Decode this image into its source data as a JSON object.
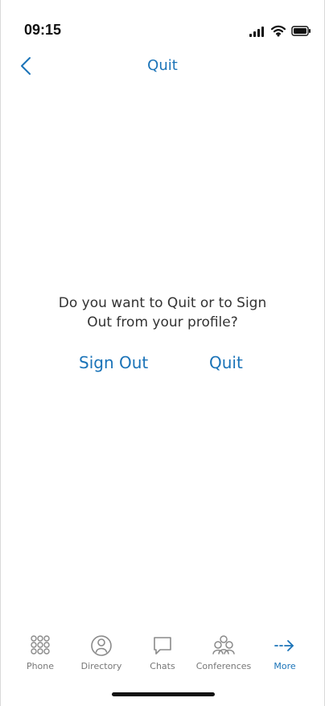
{
  "status": {
    "time": "09:15"
  },
  "header": {
    "title": "Quit"
  },
  "dialog": {
    "message": "Do you want to Quit or to Sign Out from your profile?",
    "sign_out_label": "Sign Out",
    "quit_label": "Quit"
  },
  "tabbar": {
    "items": [
      {
        "label": "Phone",
        "icon": "phone-keypad-icon",
        "active": false
      },
      {
        "label": "Directory",
        "icon": "directory-person-icon",
        "active": false
      },
      {
        "label": "Chats",
        "icon": "chat-bubble-icon",
        "active": false
      },
      {
        "label": "Conferences",
        "icon": "conferences-group-icon",
        "active": false
      },
      {
        "label": "More",
        "icon": "more-arrow-icon",
        "active": true
      }
    ]
  },
  "colors": {
    "accent": "#1a73b8",
    "text": "#333333",
    "inactive": "#777777",
    "background": "#ffffff"
  }
}
